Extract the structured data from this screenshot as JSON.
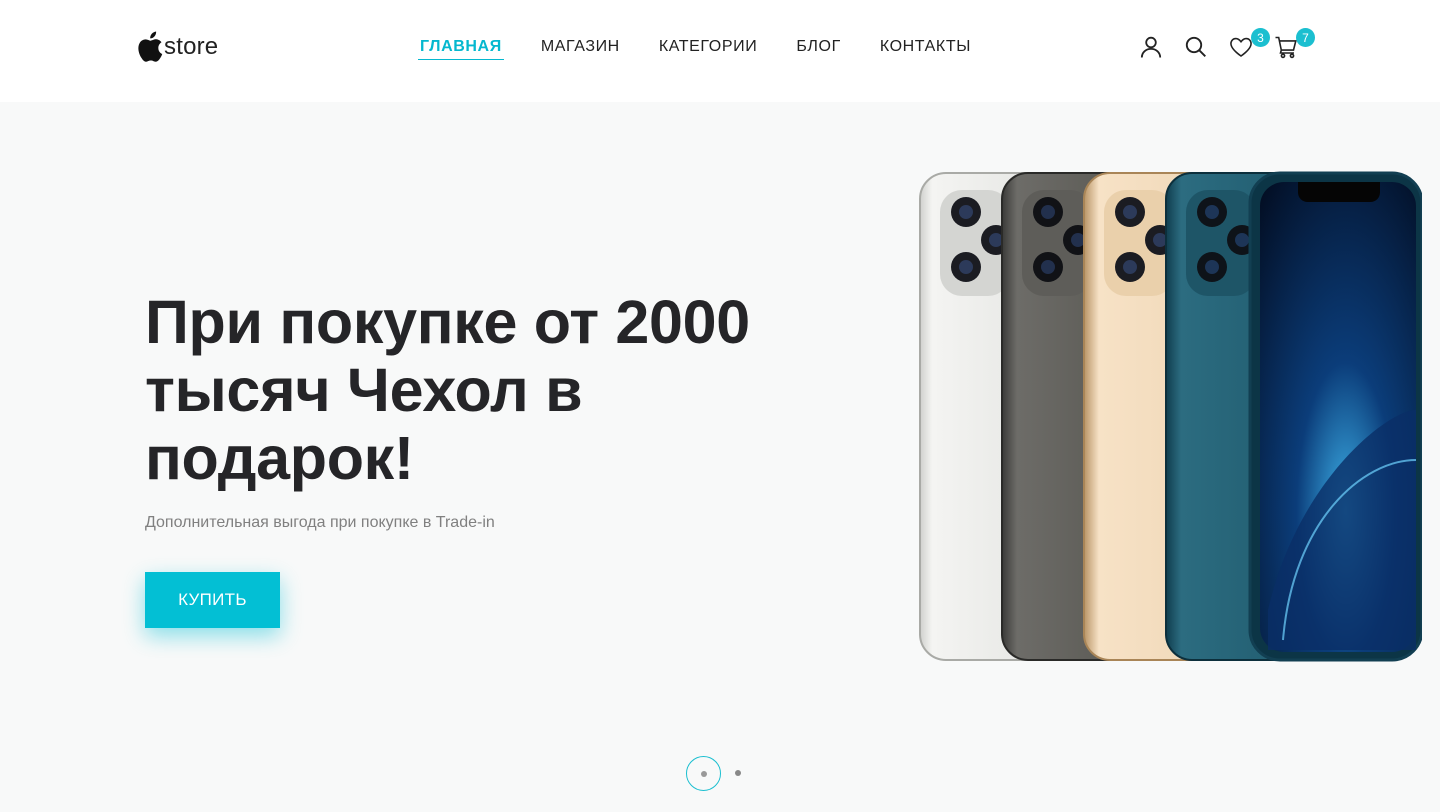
{
  "header": {
    "logo_text": "store",
    "nav": [
      {
        "label": "ГЛАВНАЯ",
        "active": true
      },
      {
        "label": "МАГАЗИН",
        "active": false
      },
      {
        "label": "КАТЕГОРИИ",
        "active": false
      },
      {
        "label": "БЛОГ",
        "active": false
      },
      {
        "label": "КОНТАКТЫ",
        "active": false
      }
    ],
    "icons": {
      "account": "user-icon",
      "search": "search-icon",
      "wishlist": "heart-icon",
      "cart": "cart-icon"
    },
    "wishlist_count": "3",
    "cart_count": "7"
  },
  "hero": {
    "title": "При покупке от 2000 тысяч Чехол в подарок!",
    "subtitle": "Дополнительная выгода при покупке в Trade-in",
    "button_label": "КУПИТЬ",
    "slides_total": 2,
    "active_slide": 1
  },
  "colors": {
    "accent": "#03bfd4",
    "text_dark": "#252528",
    "hero_bg": "#f8f9f9"
  }
}
